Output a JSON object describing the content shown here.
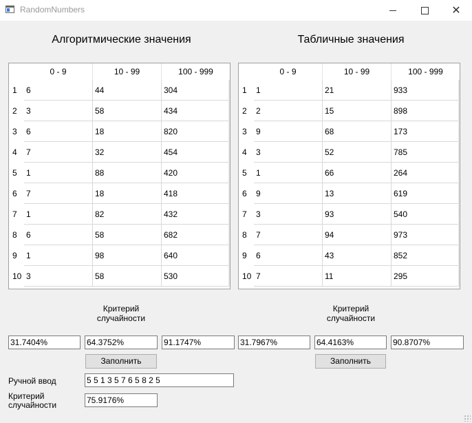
{
  "window": {
    "title": "RandomNumbers",
    "icon": "app-window-icon",
    "controls": [
      "minimize-icon",
      "maximize-icon",
      "close-icon"
    ]
  },
  "left_panel": {
    "heading": "Алгоритмические значения",
    "columns": [
      "0 - 9",
      "10 - 99",
      "100 - 999"
    ],
    "row_headers": [
      "1",
      "2",
      "3",
      "4",
      "5",
      "6",
      "7",
      "8",
      "9",
      "10"
    ],
    "rows": [
      [
        "6",
        "44",
        "304"
      ],
      [
        "3",
        "58",
        "434"
      ],
      [
        "6",
        "18",
        "820"
      ],
      [
        "7",
        "32",
        "454"
      ],
      [
        "1",
        "88",
        "420"
      ],
      [
        "7",
        "18",
        "418"
      ],
      [
        "1",
        "82",
        "432"
      ],
      [
        "6",
        "58",
        "682"
      ],
      [
        "1",
        "98",
        "640"
      ],
      [
        "3",
        "58",
        "530"
      ]
    ],
    "criterion_label_line1": "Критерий",
    "criterion_label_line2": "случайности",
    "criterion_values": [
      "31.7404%",
      "64.3752%",
      "91.1747%"
    ],
    "fill_button": "Заполнить"
  },
  "right_panel": {
    "heading": "Табличные значения",
    "columns": [
      "0 - 9",
      "10 - 99",
      "100 - 999"
    ],
    "row_headers": [
      "1",
      "2",
      "3",
      "4",
      "5",
      "6",
      "7",
      "8",
      "9",
      "10"
    ],
    "rows": [
      [
        "1",
        "21",
        "933"
      ],
      [
        "2",
        "15",
        "898"
      ],
      [
        "9",
        "68",
        "173"
      ],
      [
        "3",
        "52",
        "785"
      ],
      [
        "1",
        "66",
        "264"
      ],
      [
        "9",
        "13",
        "619"
      ],
      [
        "3",
        "93",
        "540"
      ],
      [
        "7",
        "94",
        "973"
      ],
      [
        "6",
        "43",
        "852"
      ],
      [
        "7",
        "11",
        "295"
      ]
    ],
    "criterion_label_line1": "Критерий",
    "criterion_label_line2": "случайности",
    "criterion_values": [
      "31.7967%",
      "64.4163%",
      "90.8707%"
    ],
    "fill_button": "Заполнить"
  },
  "manual": {
    "input_label": "Ручной ввод",
    "input_value": "5 5 1 3 5 7 6 5 8 2 5",
    "criterion_label_line1": "Критерий",
    "criterion_label_line2": "случайности",
    "criterion_value": "75.9176%"
  }
}
